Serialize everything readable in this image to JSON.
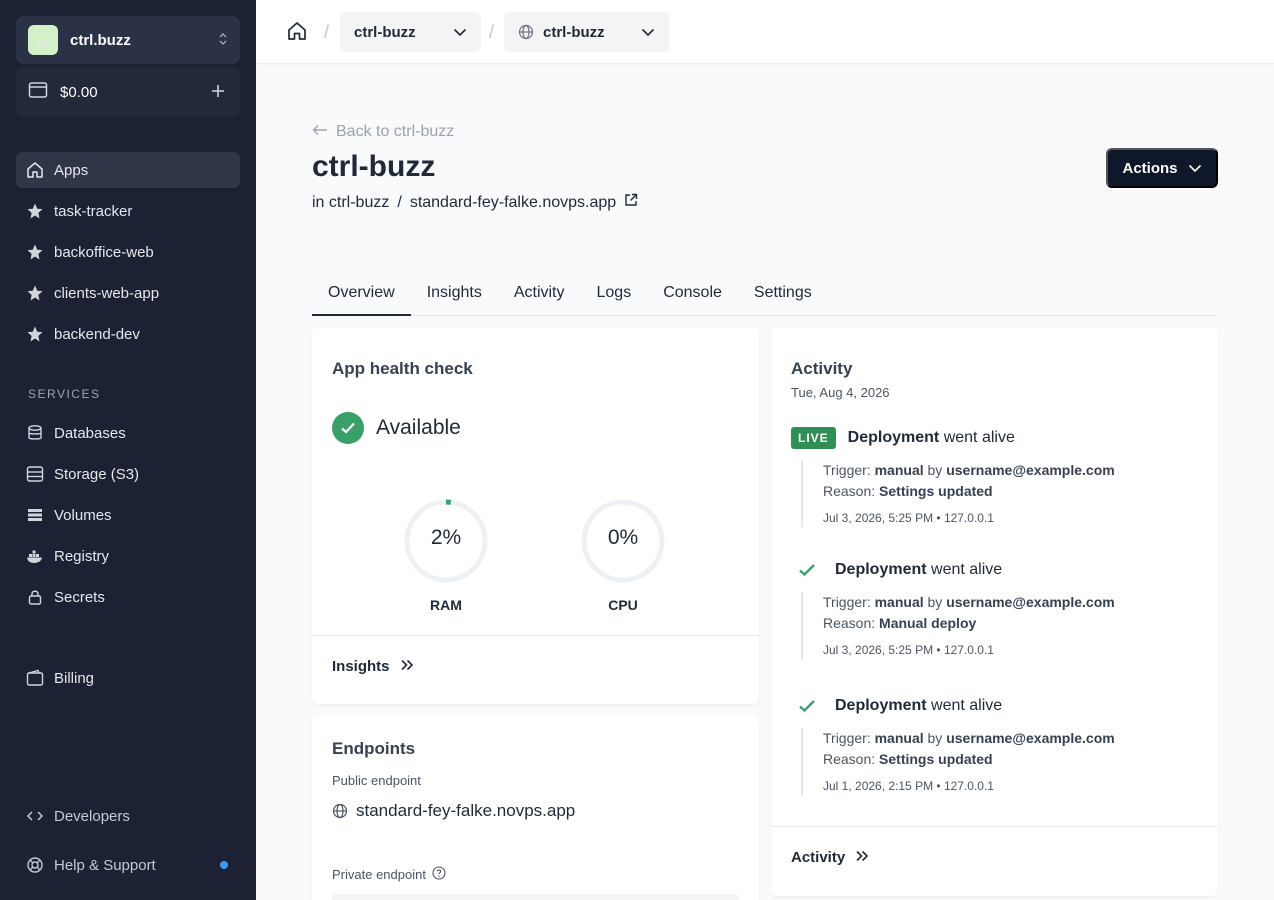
{
  "sidebar": {
    "team_name": "ctrl.buzz",
    "team_avatar": "☕",
    "balance": "$0.00",
    "nav": [
      {
        "label": "Apps",
        "icon": "home-icon"
      },
      {
        "label": "task-tracker",
        "icon": "star-icon"
      },
      {
        "label": "backoffice-web",
        "icon": "star-icon"
      },
      {
        "label": "clients-web-app",
        "icon": "star-icon"
      },
      {
        "label": "backend-dev",
        "icon": "star-icon"
      }
    ],
    "services_label": "SERVICES",
    "services": [
      {
        "label": "Databases",
        "icon": "database-icon"
      },
      {
        "label": "Storage (S3)",
        "icon": "storage-icon"
      },
      {
        "label": "Volumes",
        "icon": "volumes-icon"
      },
      {
        "label": "Registry",
        "icon": "docker-icon"
      },
      {
        "label": "Secrets",
        "icon": "lock-icon"
      }
    ],
    "billing": "Billing",
    "developers": "Developers",
    "help": "Help & Support"
  },
  "topbar": {
    "project": "ctrl-buzz",
    "environment": "ctrl-buzz"
  },
  "header": {
    "back_label": "Back to ctrl-buzz",
    "title": "ctrl-buzz",
    "in_label": "in ctrl-buzz",
    "separator": "/",
    "domain": "standard-fey-falke.novps.app",
    "actions_label": "Actions"
  },
  "tabs": [
    "Overview",
    "Insights",
    "Activity",
    "Logs",
    "Console",
    "Settings"
  ],
  "health": {
    "title": "App health check",
    "status": "Available",
    "ram_value": "2%",
    "ram_label": "RAM",
    "ram_percent": 2,
    "cpu_value": "0%",
    "cpu_label": "CPU",
    "cpu_percent": 0,
    "link": "Insights"
  },
  "endpoints": {
    "title": "Endpoints",
    "public_label": "Public endpoint",
    "public_value": "standard-fey-falke.novps.app",
    "private_label": "Private endpoint"
  },
  "activity": {
    "title": "Activity",
    "date": "Tue, Aug 4, 2026",
    "live_badge": "LIVE",
    "events": [
      {
        "title": "Deployment",
        "suffix": "went alive",
        "trigger_label": "Trigger:",
        "trigger": "manual",
        "by": "by",
        "user": "username@example.com",
        "reason_label": "Reason:",
        "reason": "Settings updated",
        "meta": "Jul 3, 2026, 5:25 PM • 127.0.0.1"
      },
      {
        "title": "Deployment",
        "suffix": "went alive",
        "trigger_label": "Trigger:",
        "trigger": "manual",
        "by": "by",
        "user": "username@example.com",
        "reason_label": "Reason:",
        "reason": "Manual deploy",
        "meta": "Jul 3, 2026, 5:25 PM • 127.0.0.1"
      },
      {
        "title": "Deployment",
        "suffix": "went alive",
        "trigger_label": "Trigger:",
        "trigger": "manual",
        "by": "by",
        "user": "username@example.com",
        "reason_label": "Reason:",
        "reason": "Settings updated",
        "meta": "Jul 1, 2026, 2:15 PM • 127.0.0.1"
      }
    ],
    "link": "Activity"
  },
  "colors": {
    "sidebar_bg": "#1c2233",
    "success": "#38a169",
    "primary_dark": "#0f172a",
    "notification_dot": "#3b9af0"
  }
}
